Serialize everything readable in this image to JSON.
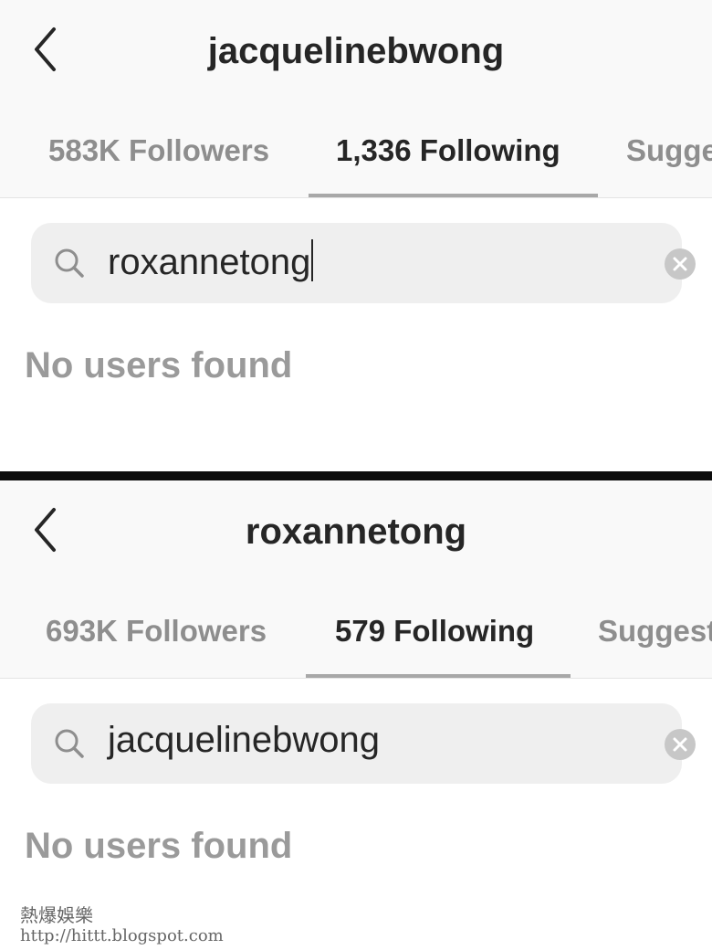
{
  "top": {
    "title": "jacquelinebwong",
    "tabs": [
      {
        "label": "583K Followers",
        "active": false
      },
      {
        "label": "1,336 Following",
        "active": true
      },
      {
        "label": "Sugge",
        "active": false
      }
    ],
    "search": {
      "value": "roxannetong",
      "placeholder": "Search"
    },
    "empty_message": "No users found"
  },
  "bottom": {
    "title": "roxannetong",
    "tabs": [
      {
        "label": "693K Followers",
        "active": false
      },
      {
        "label": "579 Following",
        "active": true
      },
      {
        "label": "Suggest",
        "active": false
      }
    ],
    "search": {
      "value": "jacquelinebwong",
      "placeholder": "Search"
    },
    "empty_message": "No users found"
  },
  "watermark": {
    "logo": "熱爆娛樂",
    "url": "http://hittt.blogspot.com"
  },
  "icons": {
    "back": "chevron-left-icon",
    "search": "magnifier-icon",
    "clear": "clear-x-icon"
  },
  "colors": {
    "text_primary": "#262626",
    "text_secondary": "#8e8e8e",
    "search_background": "#efefef",
    "tab_indicator": "#a8a8a8",
    "divider": "#0d0d0d"
  }
}
